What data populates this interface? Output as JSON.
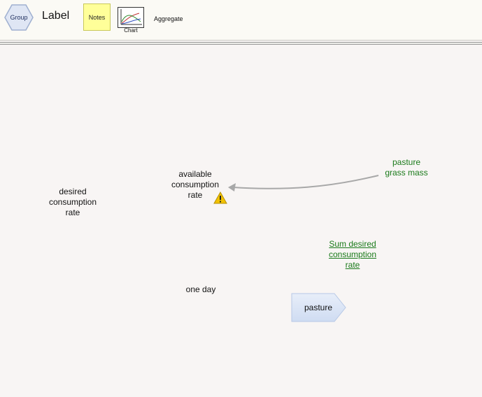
{
  "toolbar": {
    "group_label": "Group",
    "label_label": "Label",
    "notes_label": "Notes",
    "chart_label": "Chart",
    "aggregate_label": "Aggregate"
  },
  "canvas": {
    "desired_consumption_rate": "desired\nconsumption\nrate",
    "available_consumption_rate": "available\nconsumption\nrate",
    "pasture_grass_mass": "pasture\ngrass mass",
    "sum_desired_consumption_rate": "Sum desired\nconsumption\nrate",
    "one_day": "one day",
    "pasture": "pasture"
  },
  "colors": {
    "link_text": "#1a7a1a",
    "arrow": "#a8a8a8",
    "stock_fill": "#dde7f6",
    "warning": "#f2c200"
  },
  "icons": [
    "hexagon-group-icon",
    "chart-icon",
    "warning-icon",
    "arrow-icon"
  ]
}
